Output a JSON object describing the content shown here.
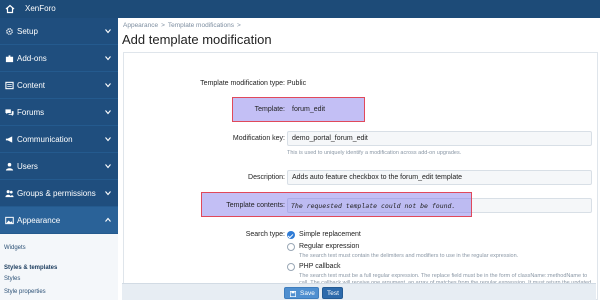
{
  "app": {
    "brand": "XenForo"
  },
  "sidebar": {
    "items": [
      {
        "label": "Setup"
      },
      {
        "label": "Add-ons"
      },
      {
        "label": "Content"
      },
      {
        "label": "Forums"
      },
      {
        "label": "Communication"
      },
      {
        "label": "Users"
      },
      {
        "label": "Groups & permissions"
      },
      {
        "label": "Appearance"
      }
    ],
    "sub_items": [
      {
        "label": "Widgets"
      },
      {
        "label": "Styles & templates"
      },
      {
        "label": "Styles"
      },
      {
        "label": "Style properties"
      }
    ]
  },
  "breadcrumb": {
    "items": [
      "Appearance",
      "Template modifications"
    ]
  },
  "page": {
    "title": "Add template modification"
  },
  "form": {
    "type_label": "Template modification type:",
    "type_value": "Public",
    "template_label": "Template:",
    "template_value": "forum_edit",
    "key_label": "Modification key:",
    "key_value": "demo_portal_forum_edit",
    "key_hint": "This is used to uniquely identify a modification across add-on upgrades.",
    "desc_label": "Description:",
    "desc_value": "Adds auto feature checkbox to the forum_edit template",
    "contents_label": "Template contents:",
    "contents_value": "The requested template could not be found.",
    "search_label": "Search type:",
    "search_options": [
      {
        "label": "Simple replacement",
        "selected": true
      },
      {
        "label": "Regular expression",
        "hint": "The search text must contain the delimiters and modifiers to use in the regular expression.",
        "selected": false
      },
      {
        "label": "PHP callback",
        "hint": "The search text must be a full regular expression. The replace field must be in the form of className::methodName to call. The callback will receive one argument, an array of matches from the regular expression. It must return the updated template string.",
        "selected": false
      }
    ]
  },
  "actions": {
    "save_label": "Save",
    "test_label": "Test"
  },
  "colors": {
    "topbar": "#1d4b78",
    "sidebar": "#1f4e7e",
    "highlight": "#7a70e8",
    "highlight_border": "#e0495b",
    "primary_button": "#4f8fd0"
  }
}
